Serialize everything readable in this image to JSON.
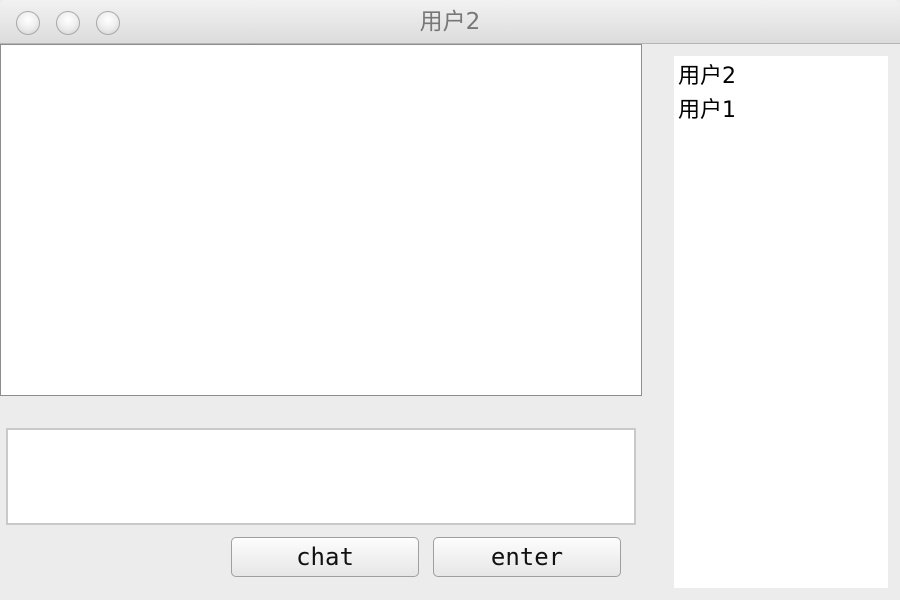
{
  "window": {
    "title": "用户2"
  },
  "chat": {
    "messages_text": "",
    "input_value": ""
  },
  "buttons": {
    "chat_label": "chat",
    "enter_label": "enter"
  },
  "users": {
    "items": [
      {
        "name": "用户2"
      },
      {
        "name": "用户1"
      }
    ]
  }
}
